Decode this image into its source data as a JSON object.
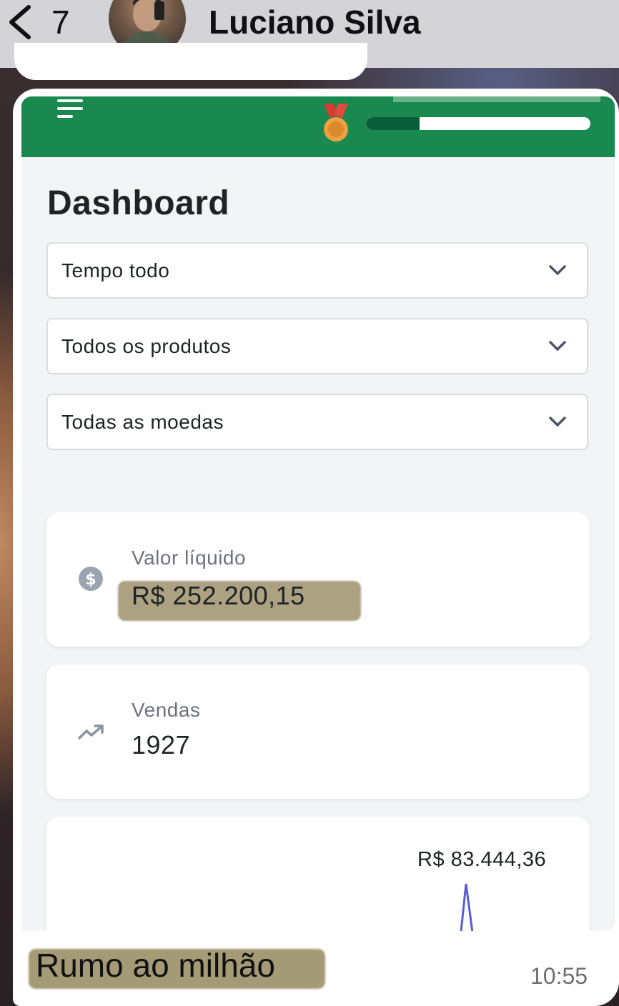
{
  "chat": {
    "back_count": "7",
    "contact_name": "Luciano Silva",
    "caption": "Rumo ao milhão",
    "time": "10:55"
  },
  "app": {
    "progress_fraction": 0.24,
    "page_title": "Dashboard",
    "filters": {
      "period": "Tempo todo",
      "products": "Todos os produtos",
      "currency": "Todas as moedas"
    },
    "cards": {
      "net_value_label": "Valor líquido",
      "net_value": "R$ 252.200,15",
      "sales_label": "Vendas",
      "sales_value": "1927",
      "chart_peak_label": "R$ 83.444,36"
    }
  },
  "colors": {
    "topbar": "#19894f",
    "progress_fill": "#0b5e3a",
    "chart_line": "#5b5bd6",
    "highlight": "#8c7d50"
  }
}
